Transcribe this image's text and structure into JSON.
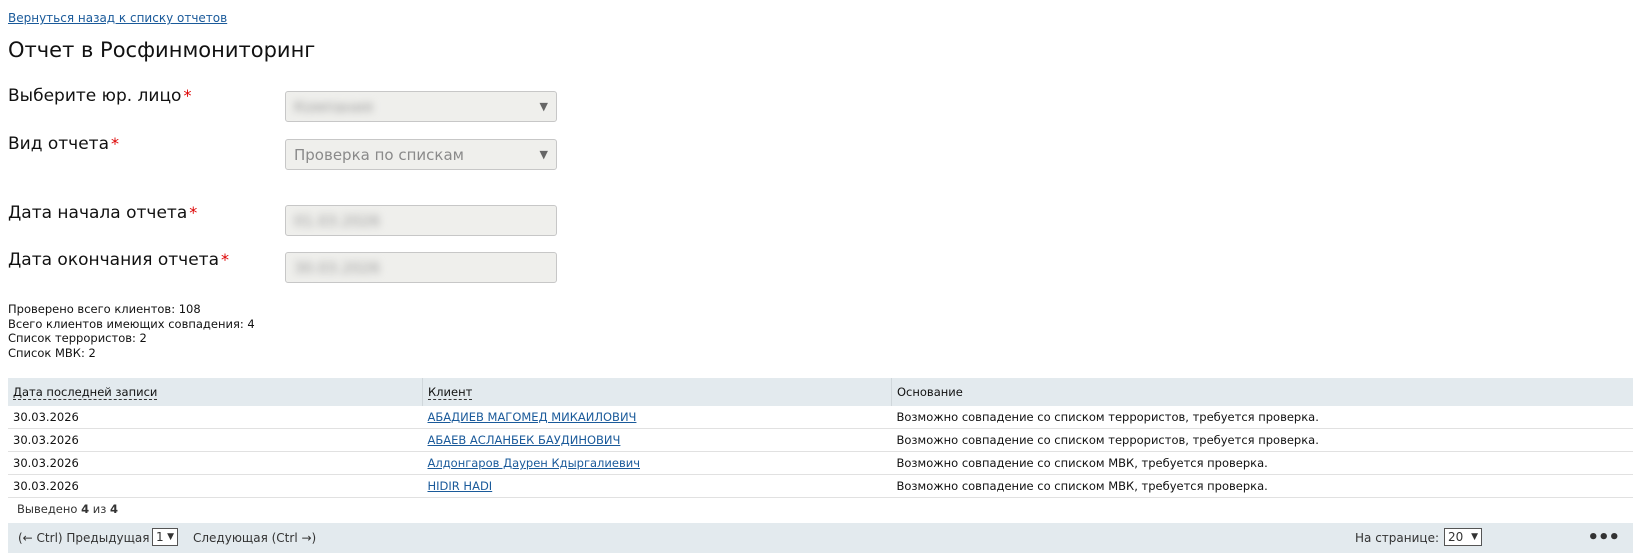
{
  "nav": {
    "back_link": "Вернуться назад к списку отчетов"
  },
  "page": {
    "title": "Отчет в Росфинмониторинг"
  },
  "form": {
    "entity": {
      "label": "Выберите юр. лицо",
      "required_mark": "*",
      "value": "Компания"
    },
    "report_type": {
      "label": "Вид отчета",
      "required_mark": "*",
      "value": "Проверка по спискам"
    },
    "start_date": {
      "label": "Дата начала отчета",
      "required_mark": "*",
      "value": "01.03.2026"
    },
    "end_date": {
      "label": "Дата окончания отчета",
      "required_mark": "*",
      "value": "30.03.2026"
    }
  },
  "stats": {
    "checked": "Проверено всего клиентов: 108",
    "matched": "Всего клиентов имеющих совпадения: 4",
    "terrorists": "Список террористов: 2",
    "mvk": "Список МВК: 2"
  },
  "table": {
    "columns": [
      "Дата последней записи",
      "Клиент",
      "Основание"
    ],
    "rows": [
      {
        "date": "30.03.2026",
        "client": "АБАДИЕВ МАГОМЕД МИКАИЛОВИЧ",
        "reason": "Возможно совпадение со списком террористов, требуется проверка."
      },
      {
        "date": "30.03.2026",
        "client": "АБАЕВ АСЛАНБЕК БАУДИНОВИЧ",
        "reason": "Возможно совпадение со списком террористов, требуется проверка."
      },
      {
        "date": "30.03.2026",
        "client": "Алдонгаров Даурен Кдыргалиевич",
        "reason": "Возможно совпадение со списком МВК, требуется проверка."
      },
      {
        "date": "30.03.2026",
        "client": "HIDIR HADI",
        "reason": "Возможно совпадение со списком МВК, требуется проверка."
      }
    ]
  },
  "summary": {
    "prefix": "Выведено",
    "shown": "4",
    "of": "из",
    "total": "4"
  },
  "pager": {
    "prev": "(← Ctrl) Предыдущая",
    "page": "1",
    "next": "Следующая (Ctrl →)",
    "per_page_label": "На странице:",
    "per_page": "20",
    "more": "•••"
  },
  "colors": {
    "link": "#1a5a9a",
    "required": "#dd0000",
    "header_bg": "#e3eaee"
  },
  "icons": {
    "dropdown": "chevron-down-icon",
    "more": "more-dots-icon"
  }
}
